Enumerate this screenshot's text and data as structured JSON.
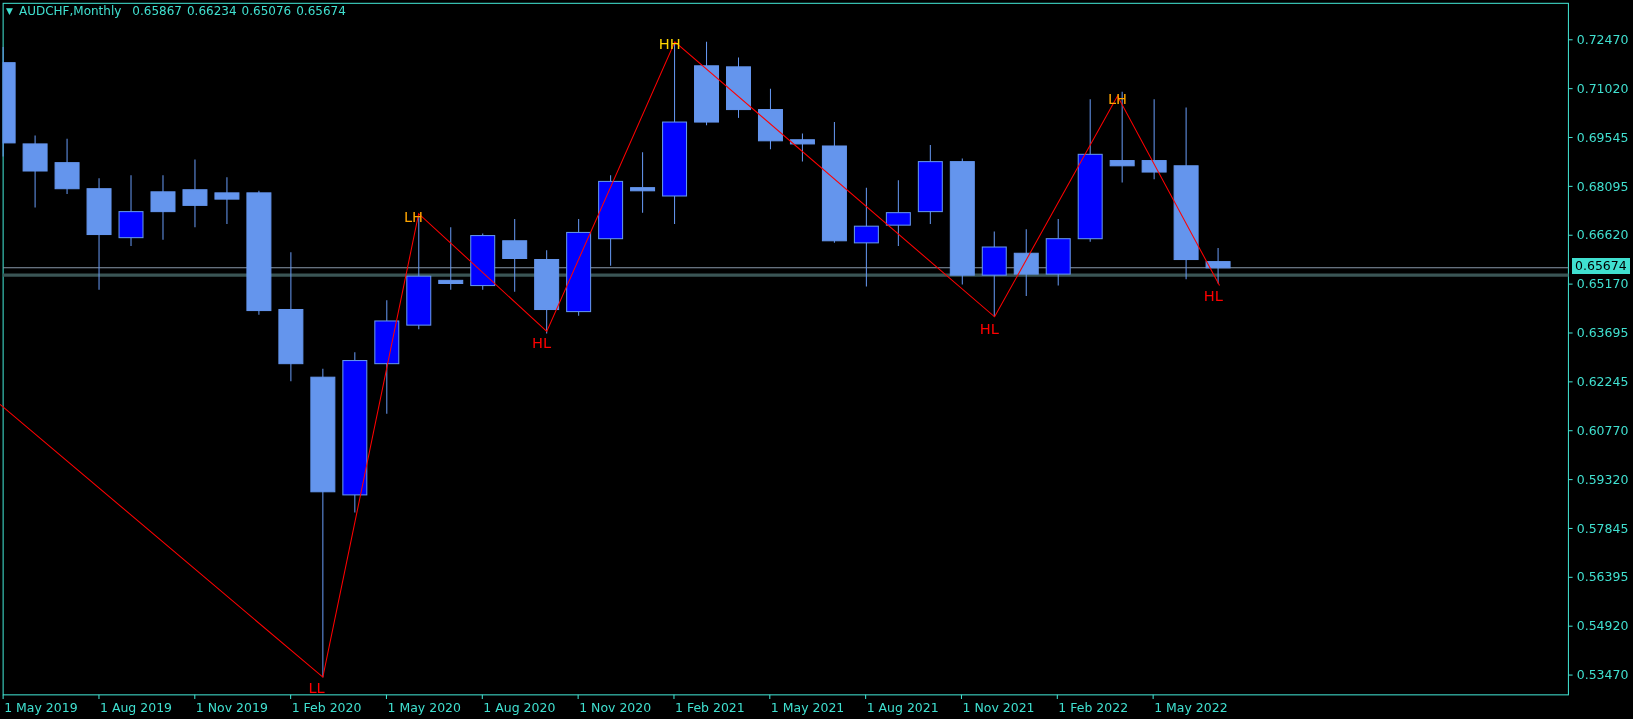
{
  "window": {
    "title": "AUDCHF,Monthly"
  },
  "header": {
    "menu_symbol": "▼",
    "quote": [
      "0.65867",
      "0.66234",
      "0.65076",
      "0.65674"
    ]
  },
  "price_axis": [
    "0.72470",
    "0.71020",
    "0.69545",
    "0.68095",
    "0.66620",
    "0.65170",
    "0.63695",
    "0.62245",
    "0.60770",
    "0.59320",
    "0.57845",
    "0.56395",
    "0.54920",
    "0.53470"
  ],
  "current_price": "0.65674",
  "time_axis": [
    "1 May 2019",
    "1 Aug 2019",
    "1 Nov 2019",
    "1 Feb 2020",
    "1 May 2020",
    "1 Aug 2020",
    "1 Nov 2020",
    "1 Feb 2021",
    "1 May 2021",
    "1 Aug 2021",
    "1 Nov 2021",
    "1 Feb 2022",
    "1 May 2022"
  ],
  "markers": [
    {
      "label": "LL",
      "color": "#ff0000"
    },
    {
      "label": "LH",
      "color": "#ffa500"
    },
    {
      "label": "HL",
      "color": "#ff0000"
    },
    {
      "label": "HH",
      "color": "#ffd700"
    },
    {
      "label": "HL",
      "color": "#ff0000"
    },
    {
      "label": "LH",
      "color": "#ffa500"
    },
    {
      "label": "HL",
      "color": "#ff0000"
    }
  ]
}
